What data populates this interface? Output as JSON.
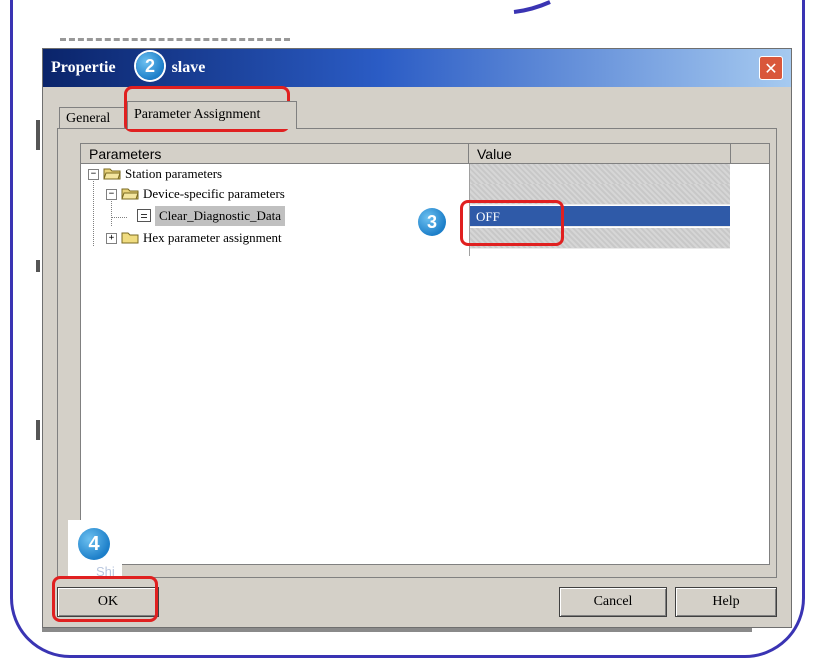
{
  "dialog": {
    "title_prefix": "Propertie",
    "title_suffix": "slave",
    "close_icon": "close-icon"
  },
  "tabs": [
    {
      "label": "General",
      "selected": false
    },
    {
      "label": "Parameter Assignment",
      "selected": true
    }
  ],
  "grid": {
    "columns": [
      "Parameters",
      "Value"
    ],
    "rows": [
      {
        "label": "Station parameters",
        "icon": "folder-open-icon",
        "expander": "−",
        "level": 0
      },
      {
        "label": "Device-specific parameters",
        "icon": "folder-open-icon",
        "expander": "−",
        "level": 1
      },
      {
        "label": "Clear_Diagnostic_Data",
        "icon": "document-icon",
        "expander": "",
        "level": 2,
        "value": "OFF",
        "selected": true
      },
      {
        "label": "Hex parameter assignment",
        "icon": "folder-icon",
        "expander": "+",
        "level": 1
      }
    ]
  },
  "buttons": {
    "ok": "OK",
    "cancel": "Cancel",
    "help": "Help"
  },
  "status_fragment": "Shi",
  "callouts": {
    "step2": "2",
    "step3": "3",
    "step4": "4"
  },
  "colors": {
    "frame": "#3a34b3",
    "highlight": "#e02020",
    "callout": "#1d7fc9",
    "selection": "#2f5aa8"
  }
}
